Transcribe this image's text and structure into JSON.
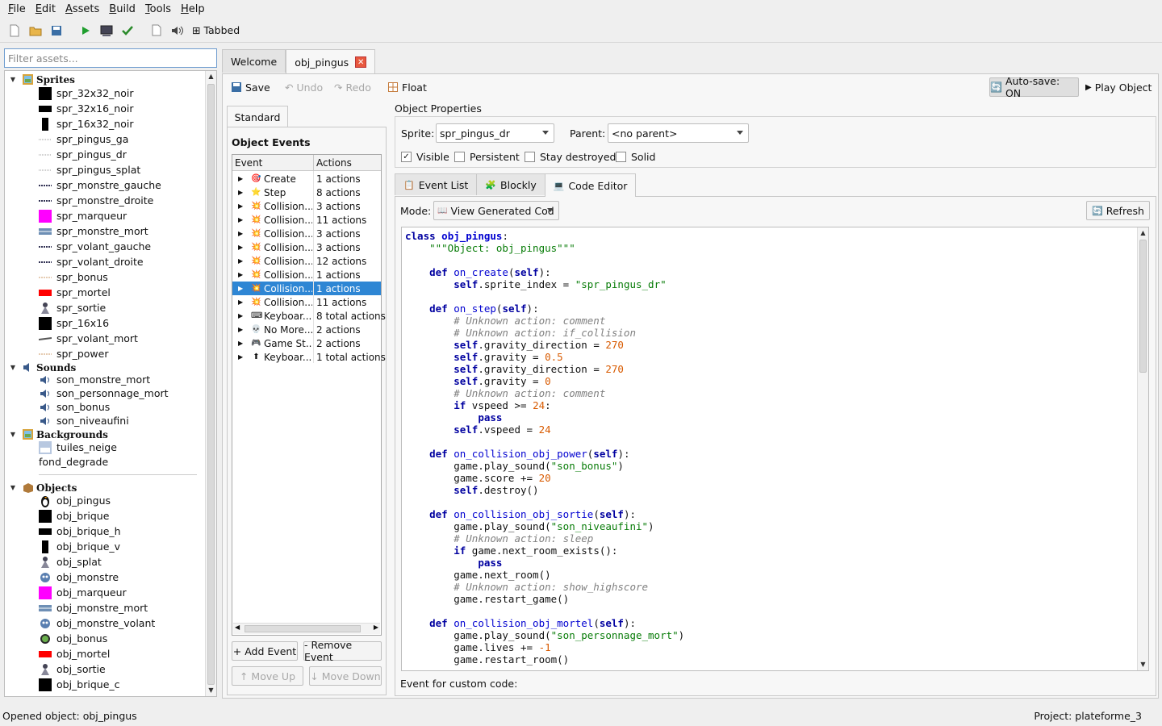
{
  "menu": [
    "File",
    "Edit",
    "Assets",
    "Build",
    "Tools",
    "Help"
  ],
  "toolbar": {
    "tabbed_label": "⊞ Tabbed"
  },
  "filter": {
    "placeholder": "Filter assets..."
  },
  "tree": {
    "sprites": {
      "label": "Sprites",
      "items": [
        "spr_32x32_noir",
        "spr_32x16_noir",
        "spr_16x32_noir",
        "spr_pingus_ga",
        "spr_pingus_dr",
        "spr_pingus_splat",
        "spr_monstre_gauche",
        "spr_monstre_droite",
        "spr_marqueur",
        "spr_monstre_mort",
        "spr_volant_gauche",
        "spr_volant_droite",
        "spr_bonus",
        "spr_mortel",
        "spr_sortie",
        "spr_16x16",
        "spr_volant_mort",
        "spr_power"
      ]
    },
    "sounds": {
      "label": "Sounds",
      "items": [
        "son_monstre_mort",
        "son_personnage_mort",
        "son_bonus",
        "son_niveaufini"
      ]
    },
    "backgrounds": {
      "label": "Backgrounds",
      "items": [
        "tuiles_neige",
        "fond_degrade"
      ]
    },
    "objects": {
      "label": "Objects",
      "items": [
        "obj_pingus",
        "obj_brique",
        "obj_brique_h",
        "obj_brique_v",
        "obj_splat",
        "obj_monstre",
        "obj_marqueur",
        "obj_monstre_mort",
        "obj_monstre_volant",
        "obj_bonus",
        "obj_mortel",
        "obj_sortie",
        "obj_brique_c"
      ]
    }
  },
  "tabs": {
    "welcome": "Welcome",
    "object": "obj_pingus",
    "close": "✕"
  },
  "editor_toolbar": {
    "save": "Save",
    "undo": "Undo",
    "redo": "Redo",
    "float": "Float",
    "autosave": "Auto-save: ON",
    "play": "Play Object"
  },
  "standard_tab": "Standard",
  "object_events": {
    "title": "Object Events",
    "col_event": "Event",
    "col_actions": "Actions",
    "rows": [
      {
        "name": "Create",
        "actions": "1 actions",
        "icon": "🎯"
      },
      {
        "name": "Step",
        "actions": "8 actions",
        "icon": "⭐"
      },
      {
        "name": "Collision...",
        "actions": "3 actions",
        "icon": "💥"
      },
      {
        "name": "Collision...",
        "actions": "11 actions",
        "icon": "💥"
      },
      {
        "name": "Collision...",
        "actions": "3 actions",
        "icon": "💥"
      },
      {
        "name": "Collision...",
        "actions": "3 actions",
        "icon": "💥"
      },
      {
        "name": "Collision...",
        "actions": "12 actions",
        "icon": "💥"
      },
      {
        "name": "Collision...",
        "actions": "1 actions",
        "icon": "💥"
      },
      {
        "name": "Collision...",
        "actions": "1 actions",
        "icon": "💥"
      },
      {
        "name": "Collision...",
        "actions": "11 actions",
        "icon": "💥"
      },
      {
        "name": "Keyboar...",
        "actions": "8 total actions",
        "icon": "⌨"
      },
      {
        "name": "No More...",
        "actions": "2 actions",
        "icon": "💀"
      },
      {
        "name": "Game St...",
        "actions": "2 actions",
        "icon": "🎮"
      },
      {
        "name": "Keyboar...",
        "actions": "1 total actions",
        "icon": "⬆"
      }
    ],
    "selected_index": 8,
    "add": "+ Add Event",
    "remove": "- Remove Event",
    "move_up": "↑ Move Up",
    "move_down": "↓ Move Down"
  },
  "properties": {
    "title": "Object Properties",
    "sprite_label": "Sprite:",
    "sprite_value": "spr_pingus_dr",
    "parent_label": "Parent:",
    "parent_value": "<no parent>",
    "visible": "Visible",
    "persistent": "Persistent",
    "stay_destroyed": "Stay destroyed",
    "solid": "Solid"
  },
  "inner_tabs": {
    "event_list": "Event List",
    "blockly": "Blockly",
    "code_editor": "Code Editor"
  },
  "code_editor": {
    "mode_label": "Mode:",
    "mode_value": "View Generated Cod",
    "refresh": "Refresh",
    "footer": "Event for custom code:"
  },
  "status": {
    "left": "Opened object: obj_pingus",
    "right": "Project: plateforme_3"
  }
}
